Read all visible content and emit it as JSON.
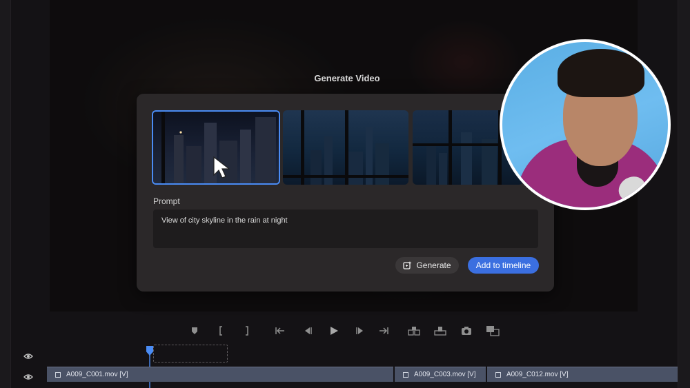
{
  "dialog": {
    "title": "Generate Video",
    "prompt_label": "Prompt",
    "prompt_value": "View of city skyline in the rain at night",
    "generate_label": "Generate",
    "add_label": "Add to timeline"
  },
  "timeline": {
    "clips": [
      {
        "name": "A009_C001.mov [V]"
      },
      {
        "name": "A009_C003.mov [V]"
      },
      {
        "name": "A009_C012.mov [V]"
      }
    ]
  },
  "transport": {
    "icons": [
      "add-marker-icon",
      "mark-in-icon",
      "mark-out-icon",
      "go-to-in-icon",
      "step-back-icon",
      "play-icon",
      "step-forward-icon",
      "go-to-out-icon",
      "insert-icon",
      "overwrite-icon",
      "export-frame-icon",
      "multicam-icon"
    ]
  },
  "colors": {
    "accent": "#3b6fe0",
    "selection": "#4a8cf5",
    "dialog_bg": "#2b2829",
    "clip": "#4a5266",
    "hoodie": "#9b2d7c"
  }
}
